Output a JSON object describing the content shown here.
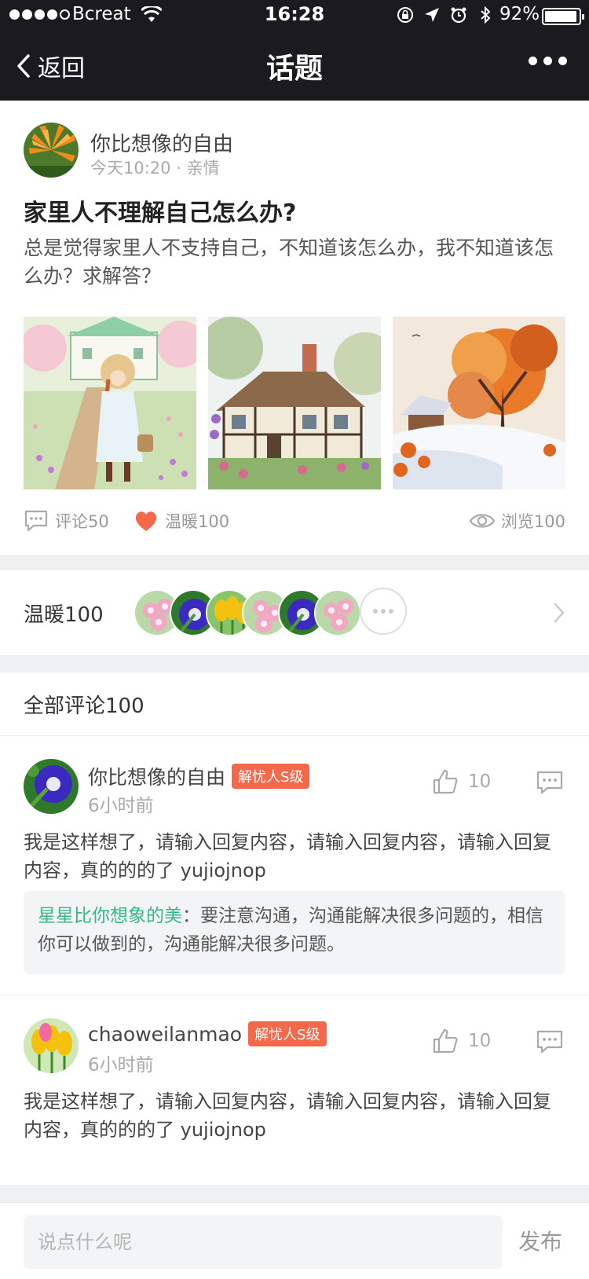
{
  "status_bar": {
    "carrier": "Bcreat",
    "time": "16:28",
    "battery_pct": "92%"
  },
  "nav": {
    "back_label": "返回",
    "title": "话题"
  },
  "post": {
    "author": "你比想像的自由",
    "time": "今天10:20",
    "separator": "·",
    "category": "亲情",
    "title": "家里人不理解自己怎么办?",
    "body": "总是觉得家里人不支持自己，不知道该怎么办，我不知道该怎么办？求解答？",
    "images": [
      "garden-girl-painting",
      "cottage-painting",
      "autumn-snow-painting"
    ],
    "actions": {
      "comments": "评论50",
      "warmth": "温暖100",
      "views": "浏览100"
    }
  },
  "warmth_row": {
    "label": "温暖100",
    "avatars": [
      "pink-flowers",
      "blue-morning-glory",
      "yellow-tulips",
      "pink-flowers",
      "blue-morning-glory",
      "pink-flowers"
    ]
  },
  "comments": {
    "title": "全部评论100",
    "items": [
      {
        "name": "你比想像的自由",
        "badge": "解忧人S级",
        "time": "6小时前",
        "likes": "10",
        "text": "我是这样想了，请输入回复内容，请输入回复内容，请输入回复内容，真的的的了 yujiojnop",
        "reply_name": "星星比你想象的美",
        "reply_text": "：要注意沟通，沟通能解决很多问题的，相信你可以做到的，沟通能解决很多问题。"
      },
      {
        "name": "chaoweilanmao",
        "badge": "解忧人S级",
        "time": "6小时前",
        "likes": "10",
        "text": "我是这样想了，请输入回复内容，请输入回复内容，请输入回复内容，真的的的了 yujiojnop"
      }
    ]
  },
  "bottom_bar": {
    "placeholder": "说点什么呢",
    "publish_label": "发布"
  },
  "colors": {
    "nav_bg": "#1b1b1f",
    "badge": "#f5684a",
    "reply_name": "#35b786",
    "heart": "#f5684a",
    "divider_bg": "#eef0f2"
  }
}
